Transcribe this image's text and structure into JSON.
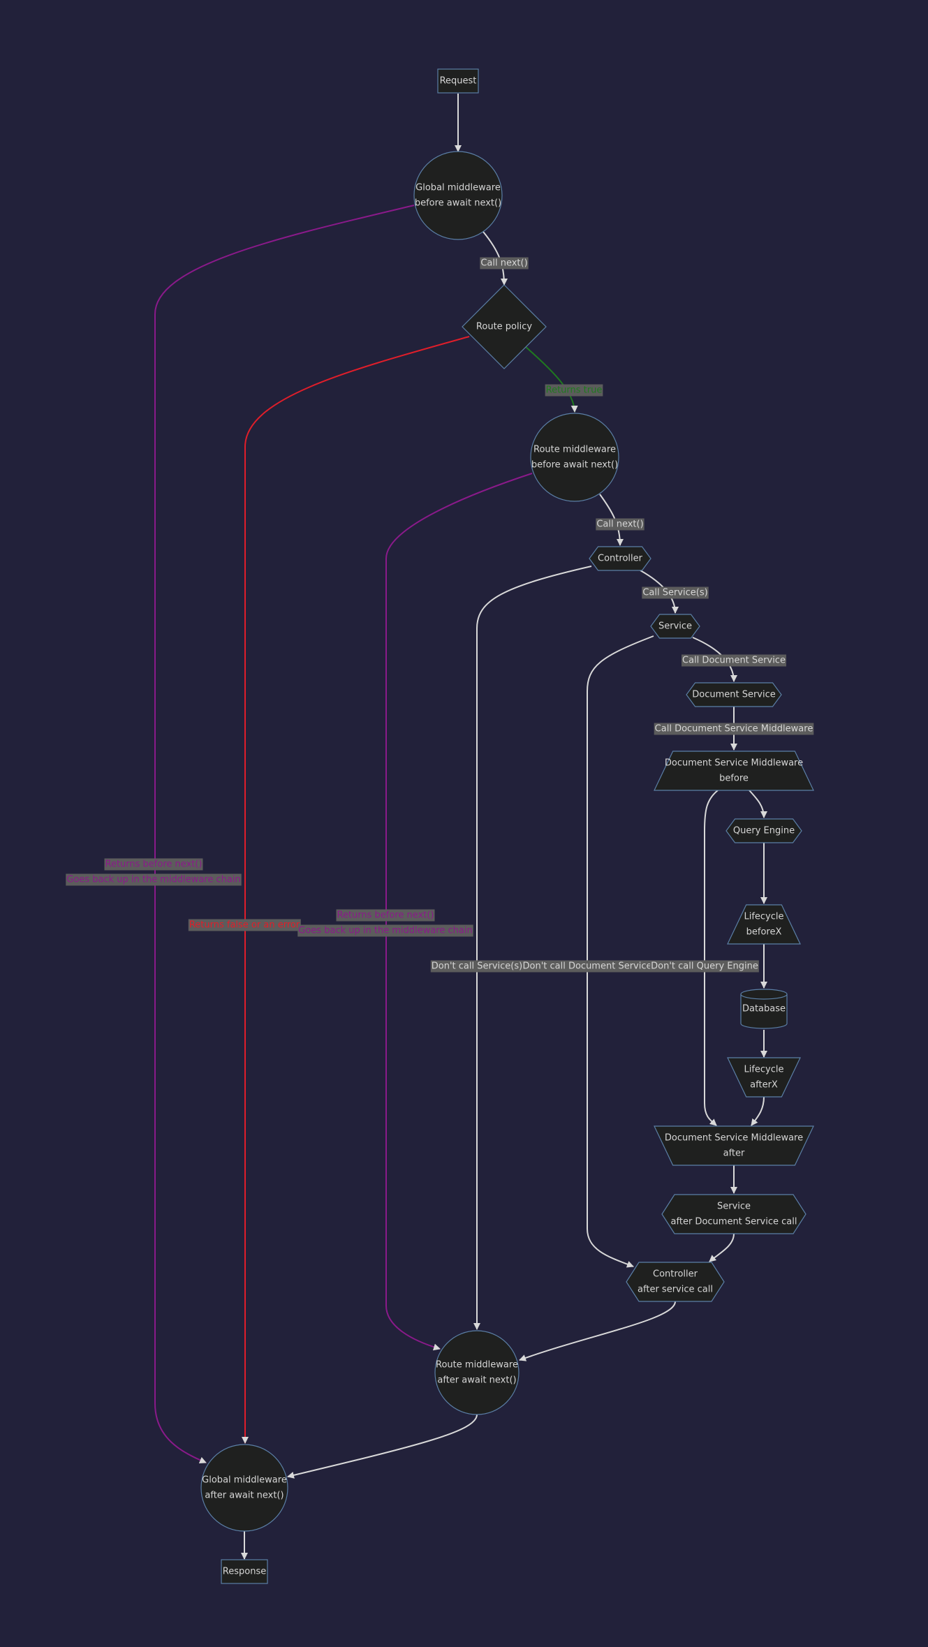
{
  "colors": {
    "background": "#22213a",
    "node_fill": "#1f201f",
    "node_stroke": "#5b7fa6",
    "node_text": "#d6d6d6",
    "edge_default": "#d9d9d9",
    "edge_purple": "#8a1a8a",
    "edge_red": "#e01e2a",
    "edge_green": "#1f7a1f",
    "label_bg": "#5c5c5c"
  },
  "nodes": [
    {
      "id": "request",
      "shape": "rect",
      "lines": [
        "Request"
      ]
    },
    {
      "id": "global_before",
      "shape": "circle",
      "lines": [
        "Global middleware",
        "before await next()"
      ]
    },
    {
      "id": "route_policy",
      "shape": "diamond",
      "lines": [
        "Route policy"
      ]
    },
    {
      "id": "route_before",
      "shape": "circle",
      "lines": [
        "Route middleware",
        "before await next()"
      ]
    },
    {
      "id": "controller",
      "shape": "hexagon",
      "lines": [
        "Controller"
      ]
    },
    {
      "id": "service",
      "shape": "hexagon",
      "lines": [
        "Service"
      ]
    },
    {
      "id": "document_service",
      "shape": "hexagon",
      "lines": [
        "Document Service"
      ]
    },
    {
      "id": "dsm_before",
      "shape": "trapezoid",
      "lines": [
        "Document Service Middleware",
        "before"
      ]
    },
    {
      "id": "query_engine",
      "shape": "hexagon",
      "lines": [
        "Query Engine"
      ]
    },
    {
      "id": "lifecycle_before",
      "shape": "trapezoid",
      "lines": [
        "Lifecycle",
        "beforeX"
      ]
    },
    {
      "id": "database",
      "shape": "cylinder",
      "lines": [
        "Database"
      ]
    },
    {
      "id": "lifecycle_after",
      "shape": "inv-trapezoid",
      "lines": [
        "Lifecycle",
        "afterX"
      ]
    },
    {
      "id": "dsm_after",
      "shape": "inv-trapezoid",
      "lines": [
        "Document Service Middleware",
        "after"
      ]
    },
    {
      "id": "service_after",
      "shape": "hexagon",
      "lines": [
        "Service",
        "after Document Service call"
      ]
    },
    {
      "id": "controller_after",
      "shape": "hexagon",
      "lines": [
        "Controller",
        "after service call"
      ]
    },
    {
      "id": "route_after",
      "shape": "circle",
      "lines": [
        "Route middleware",
        "after await next()"
      ]
    },
    {
      "id": "global_after",
      "shape": "circle",
      "lines": [
        "Global middleware",
        "after await next()"
      ]
    },
    {
      "id": "response",
      "shape": "rect",
      "lines": [
        "Response"
      ]
    }
  ],
  "edges": [
    {
      "id": "e1",
      "from": "request",
      "to": "global_before",
      "color": "default",
      "label": []
    },
    {
      "id": "e2",
      "from": "global_before",
      "to": "route_policy",
      "color": "default",
      "label": [
        "Call next()"
      ]
    },
    {
      "id": "e3",
      "from": "global_before",
      "to": "global_after",
      "color": "purple",
      "label": [
        "Returns before next()",
        "Goes back up in the middleware chain"
      ]
    },
    {
      "id": "e4",
      "from": "route_policy",
      "to": "route_before",
      "color": "green",
      "label": [
        "Returns true"
      ]
    },
    {
      "id": "e5",
      "from": "route_policy",
      "to": "global_after",
      "color": "red",
      "label": [
        "Returns false or an error"
      ]
    },
    {
      "id": "e6",
      "from": "route_before",
      "to": "controller",
      "color": "default",
      "label": [
        "Call next()"
      ]
    },
    {
      "id": "e7",
      "from": "route_before",
      "to": "route_after",
      "color": "purple",
      "label": [
        "Returns before next()",
        "Goes back up in the middleware chain"
      ]
    },
    {
      "id": "e8",
      "from": "controller",
      "to": "service",
      "color": "default",
      "label": [
        "Call Service(s)"
      ]
    },
    {
      "id": "e9",
      "from": "controller",
      "to": "route_after",
      "color": "default",
      "label": [
        "Don't call Service(s)"
      ]
    },
    {
      "id": "e10",
      "from": "service",
      "to": "document_service",
      "color": "default",
      "label": [
        "Call Document Service"
      ]
    },
    {
      "id": "e11",
      "from": "service",
      "to": "controller_after",
      "color": "default",
      "label": [
        "Don't call Document Service"
      ]
    },
    {
      "id": "e12",
      "from": "document_service",
      "to": "dsm_before",
      "color": "default",
      "label": [
        "Call Document Service Middleware"
      ]
    },
    {
      "id": "e13",
      "from": "dsm_before",
      "to": "query_engine",
      "color": "default",
      "label": []
    },
    {
      "id": "e14",
      "from": "dsm_before",
      "to": "dsm_after",
      "color": "default",
      "label": [
        "Don't call Query Engine"
      ]
    },
    {
      "id": "e15",
      "from": "query_engine",
      "to": "lifecycle_before",
      "color": "default",
      "label": []
    },
    {
      "id": "e16",
      "from": "lifecycle_before",
      "to": "database",
      "color": "default",
      "label": []
    },
    {
      "id": "e17",
      "from": "database",
      "to": "lifecycle_after",
      "color": "default",
      "label": []
    },
    {
      "id": "e18",
      "from": "lifecycle_after",
      "to": "dsm_after",
      "color": "default",
      "label": []
    },
    {
      "id": "e19",
      "from": "dsm_after",
      "to": "service_after",
      "color": "default",
      "label": []
    },
    {
      "id": "e20",
      "from": "service_after",
      "to": "controller_after",
      "color": "default",
      "label": []
    },
    {
      "id": "e21",
      "from": "controller_after",
      "to": "route_after",
      "color": "default",
      "label": []
    },
    {
      "id": "e22",
      "from": "route_after",
      "to": "global_after",
      "color": "default",
      "label": []
    },
    {
      "id": "e23",
      "from": "global_after",
      "to": "response",
      "color": "default",
      "label": []
    }
  ]
}
